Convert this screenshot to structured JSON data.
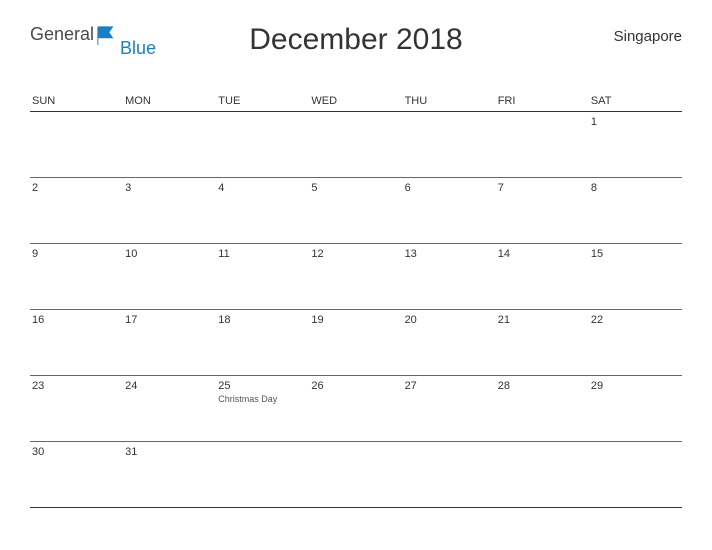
{
  "logo": {
    "general": "General",
    "blue": "Blue"
  },
  "title": "December 2018",
  "country": "Singapore",
  "weekdays": [
    "SUN",
    "MON",
    "TUE",
    "WED",
    "THU",
    "FRI",
    "SAT"
  ],
  "weeks": [
    [
      {
        "num": "",
        "event": ""
      },
      {
        "num": "",
        "event": ""
      },
      {
        "num": "",
        "event": ""
      },
      {
        "num": "",
        "event": ""
      },
      {
        "num": "",
        "event": ""
      },
      {
        "num": "",
        "event": ""
      },
      {
        "num": "1",
        "event": ""
      }
    ],
    [
      {
        "num": "2",
        "event": ""
      },
      {
        "num": "3",
        "event": ""
      },
      {
        "num": "4",
        "event": ""
      },
      {
        "num": "5",
        "event": ""
      },
      {
        "num": "6",
        "event": ""
      },
      {
        "num": "7",
        "event": ""
      },
      {
        "num": "8",
        "event": ""
      }
    ],
    [
      {
        "num": "9",
        "event": ""
      },
      {
        "num": "10",
        "event": ""
      },
      {
        "num": "11",
        "event": ""
      },
      {
        "num": "12",
        "event": ""
      },
      {
        "num": "13",
        "event": ""
      },
      {
        "num": "14",
        "event": ""
      },
      {
        "num": "15",
        "event": ""
      }
    ],
    [
      {
        "num": "16",
        "event": ""
      },
      {
        "num": "17",
        "event": ""
      },
      {
        "num": "18",
        "event": ""
      },
      {
        "num": "19",
        "event": ""
      },
      {
        "num": "20",
        "event": ""
      },
      {
        "num": "21",
        "event": ""
      },
      {
        "num": "22",
        "event": ""
      }
    ],
    [
      {
        "num": "23",
        "event": ""
      },
      {
        "num": "24",
        "event": ""
      },
      {
        "num": "25",
        "event": "Christmas Day"
      },
      {
        "num": "26",
        "event": ""
      },
      {
        "num": "27",
        "event": ""
      },
      {
        "num": "28",
        "event": ""
      },
      {
        "num": "29",
        "event": ""
      }
    ],
    [
      {
        "num": "30",
        "event": ""
      },
      {
        "num": "31",
        "event": ""
      },
      {
        "num": "",
        "event": ""
      },
      {
        "num": "",
        "event": ""
      },
      {
        "num": "",
        "event": ""
      },
      {
        "num": "",
        "event": ""
      },
      {
        "num": "",
        "event": ""
      }
    ]
  ]
}
